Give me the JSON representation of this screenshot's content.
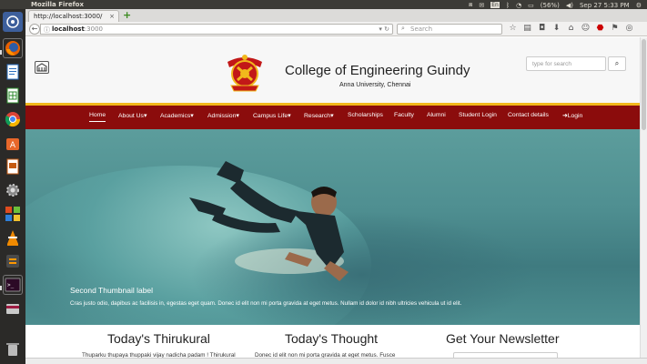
{
  "topbar": {
    "window_title": "Mozilla Firefox",
    "en_label": "En",
    "battery": "(56%)",
    "datetime": "Sep 27  5:33 PM"
  },
  "browser": {
    "tab_title": "http://localhost:3000/",
    "tab_close": "×",
    "new_tab": "+",
    "url_host": "localhost",
    "url_port": ":3000",
    "search_placeholder": "Search"
  },
  "site": {
    "title": "College of Engineering Guindy",
    "subtitle": "Anna University, Chennai",
    "search_placeholder": "type for search",
    "nav": [
      {
        "label": "Home"
      },
      {
        "label": "About Us▾"
      },
      {
        "label": "Academics▾"
      },
      {
        "label": "Admission▾"
      },
      {
        "label": "Campus Life▾"
      },
      {
        "label": "Research▾"
      },
      {
        "label": "Scholarships"
      },
      {
        "label": "Faculty"
      },
      {
        "label": "Alumni"
      },
      {
        "label": "Student Login"
      },
      {
        "label": "Contact details"
      },
      {
        "label": "➜Login"
      }
    ]
  },
  "carousel": {
    "caption_title": "Second Thumbnail label",
    "caption_text": "Cras justo odio, dapibus ac facilisis in, egestas eget quam. Donec id elit non mi porta gravida at eget metus. Nullam id dolor id nibh ultricies vehicula ut id elit.",
    "active_index": 1
  },
  "sections": {
    "thirukural": {
      "title": "Today's Thirukural",
      "text": "Thuparku thupaya thuppaki vijay nadicha padam ! Thirukural"
    },
    "thought": {
      "title": "Today's Thought",
      "text": "Donec id elit non mi porta gravida at eget metus. Fusce"
    },
    "newsletter": {
      "title": "Get Your Newsletter"
    }
  }
}
